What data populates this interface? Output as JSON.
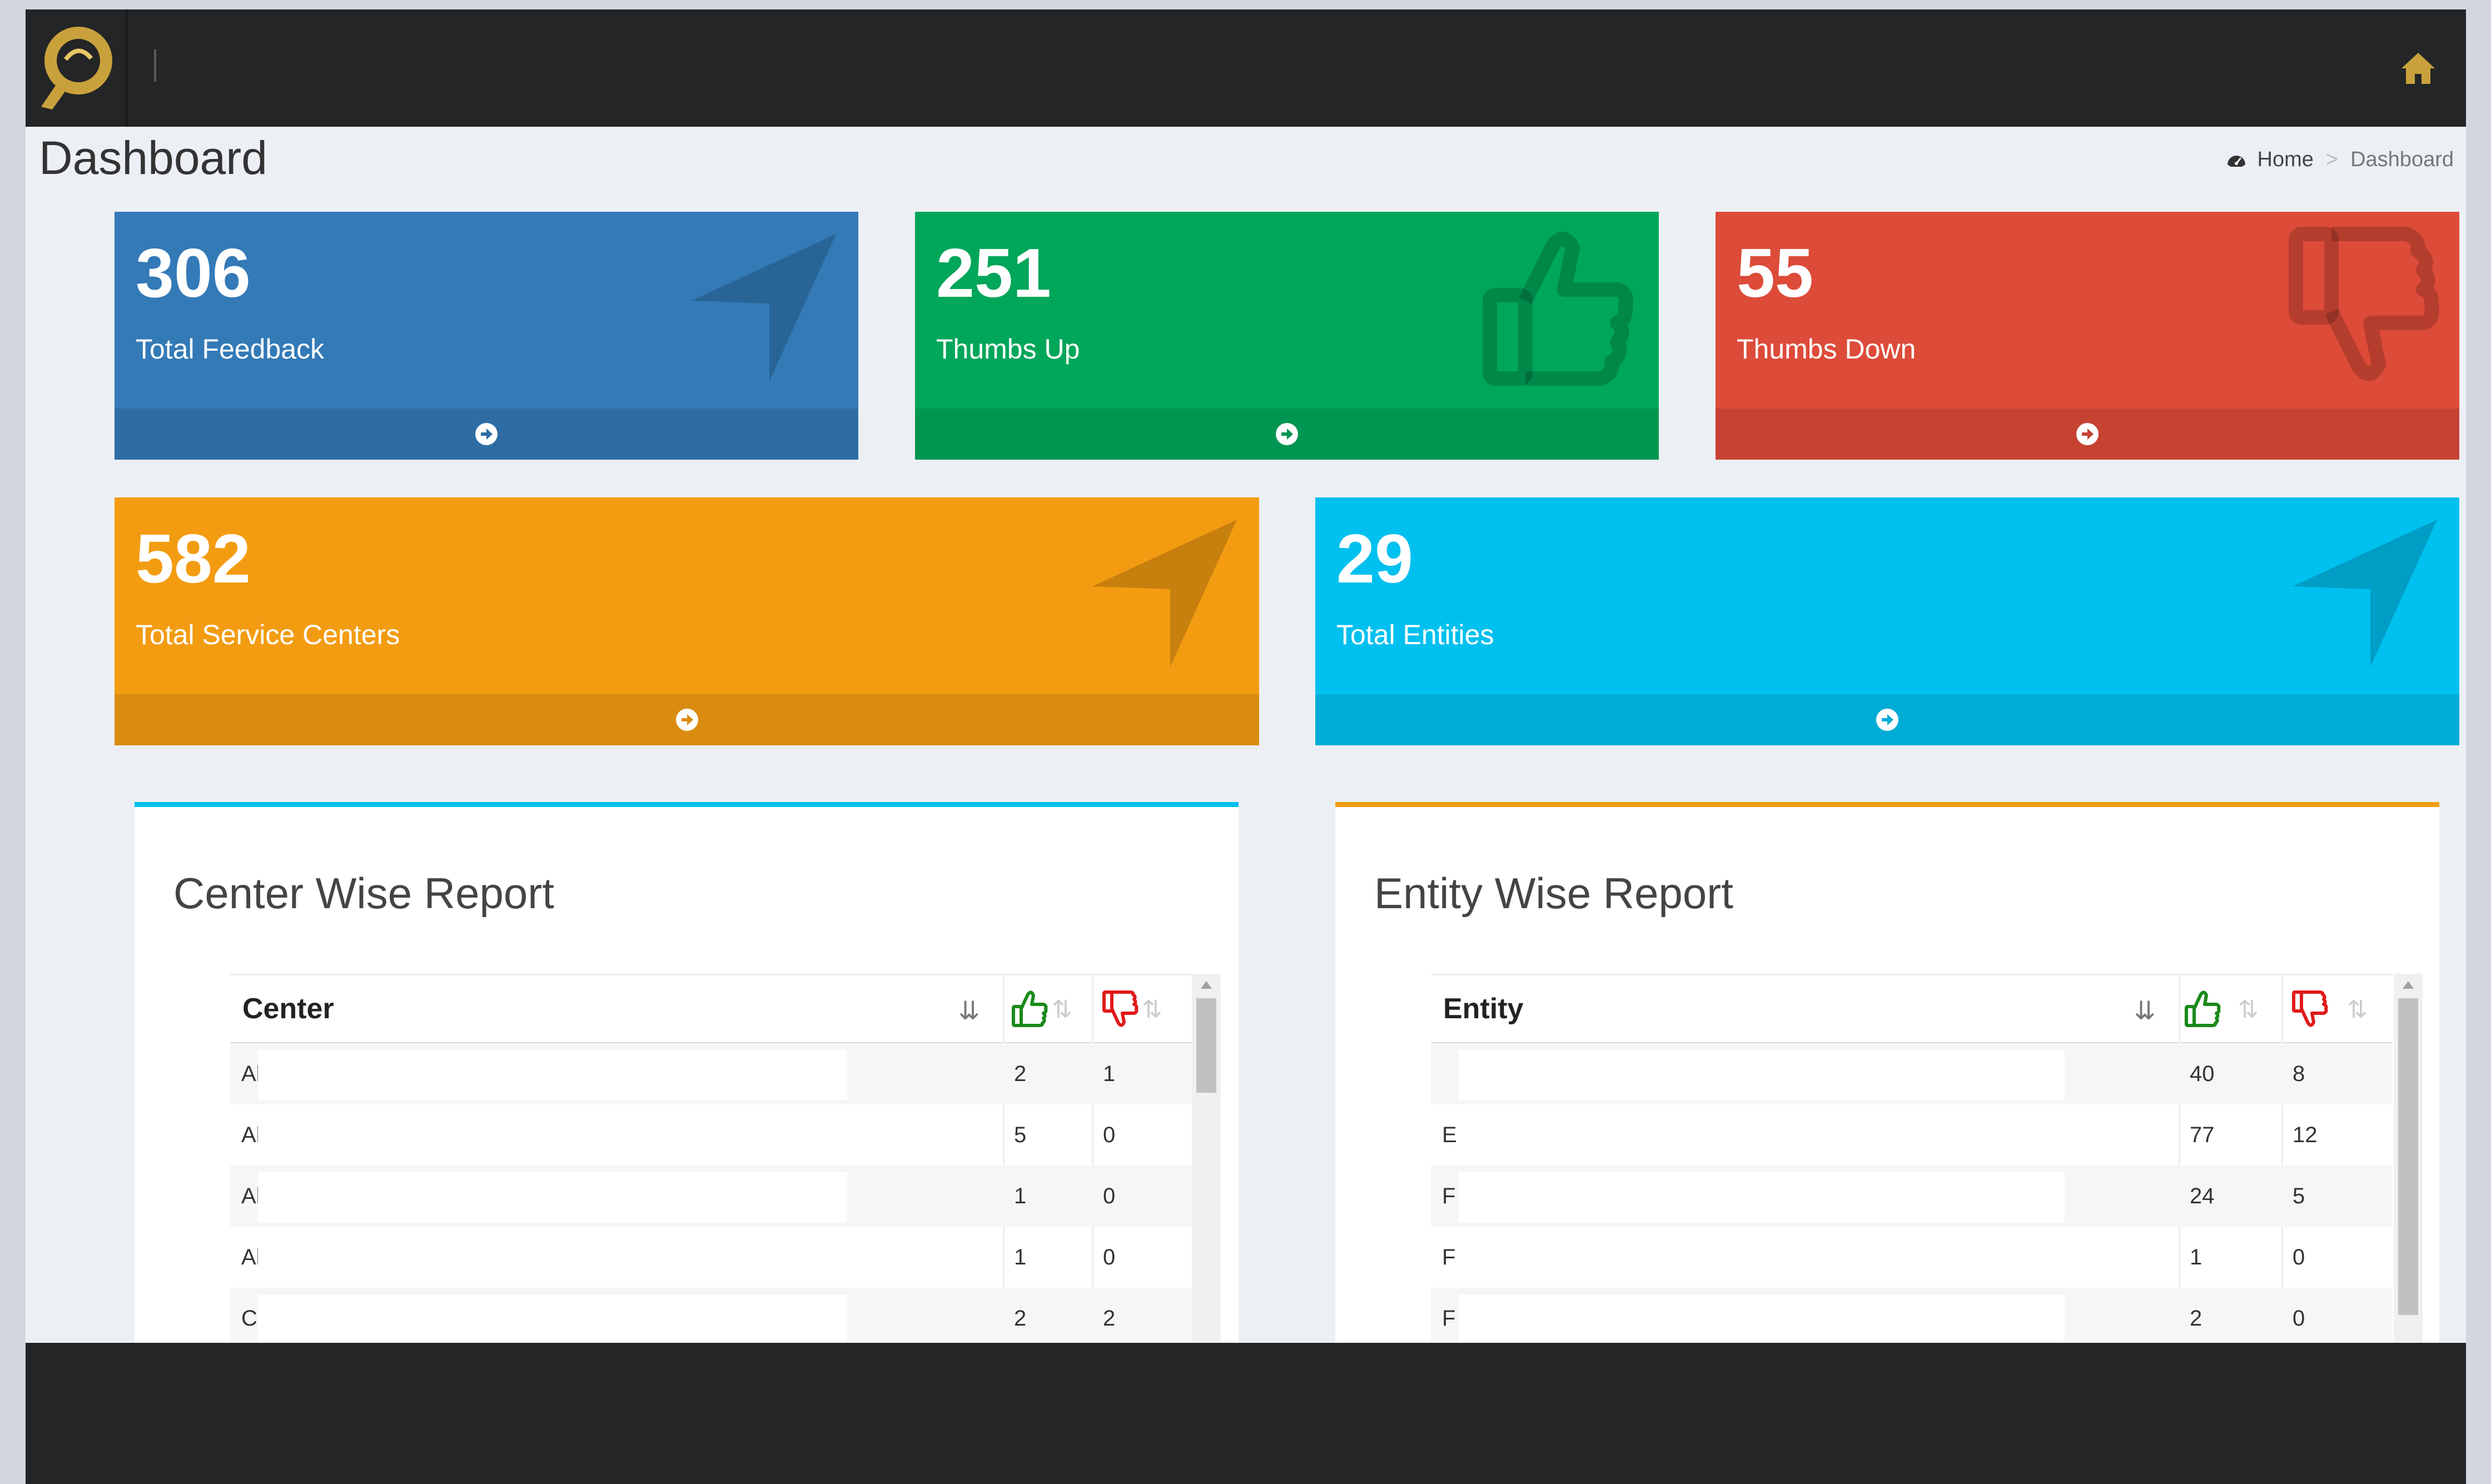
{
  "header": {
    "home_icon": "home-icon"
  },
  "page": {
    "title": "Dashboard"
  },
  "breadcrumb": {
    "home": "Home",
    "separator": ">",
    "current": "Dashboard"
  },
  "stats": [
    {
      "value": "306",
      "label": "Total Feedback",
      "color": "#337ab7",
      "footer_color": "#2e6da4",
      "icon": "location-arrow-icon"
    },
    {
      "value": "251",
      "label": "Thumbs Up",
      "color": "#00a65a",
      "footer_color": "#009551",
      "icon": "thumbs-up-icon"
    },
    {
      "value": "55",
      "label": "Thumbs Down",
      "color": "#dd4b39",
      "footer_color": "#c64333",
      "icon": "thumbs-down-icon"
    },
    {
      "value": "582",
      "label": "Total Service Centers",
      "color": "#f39c12",
      "footer_color": "#da8c10",
      "icon": "location-arrow-icon"
    },
    {
      "value": "29",
      "label": "Total Entities",
      "color": "#00c0ef",
      "footer_color": "#00acd6",
      "icon": "location-arrow-icon"
    }
  ],
  "center_report": {
    "title": "Center Wise Report",
    "accent": "#00c0ef",
    "column": "Center",
    "rows": [
      {
        "name": "Al",
        "up": "2",
        "down": "1"
      },
      {
        "name": "Al",
        "up": "5",
        "down": "0"
      },
      {
        "name": "Al",
        "up": "1",
        "down": "0"
      },
      {
        "name": "Al",
        "up": "1",
        "down": "0"
      },
      {
        "name": "C",
        "up": "2",
        "down": "2"
      }
    ]
  },
  "entity_report": {
    "title": "Entity Wise Report",
    "accent": "#f39c12",
    "column": "Entity",
    "rows": [
      {
        "name": "",
        "up": "40",
        "down": "8"
      },
      {
        "name": "E",
        "up": "77",
        "down": "12"
      },
      {
        "name": "F",
        "up": "24",
        "down": "5"
      },
      {
        "name": "F",
        "up": "1",
        "down": "0"
      },
      {
        "name": "F",
        "up": "2",
        "down": "0"
      }
    ]
  }
}
